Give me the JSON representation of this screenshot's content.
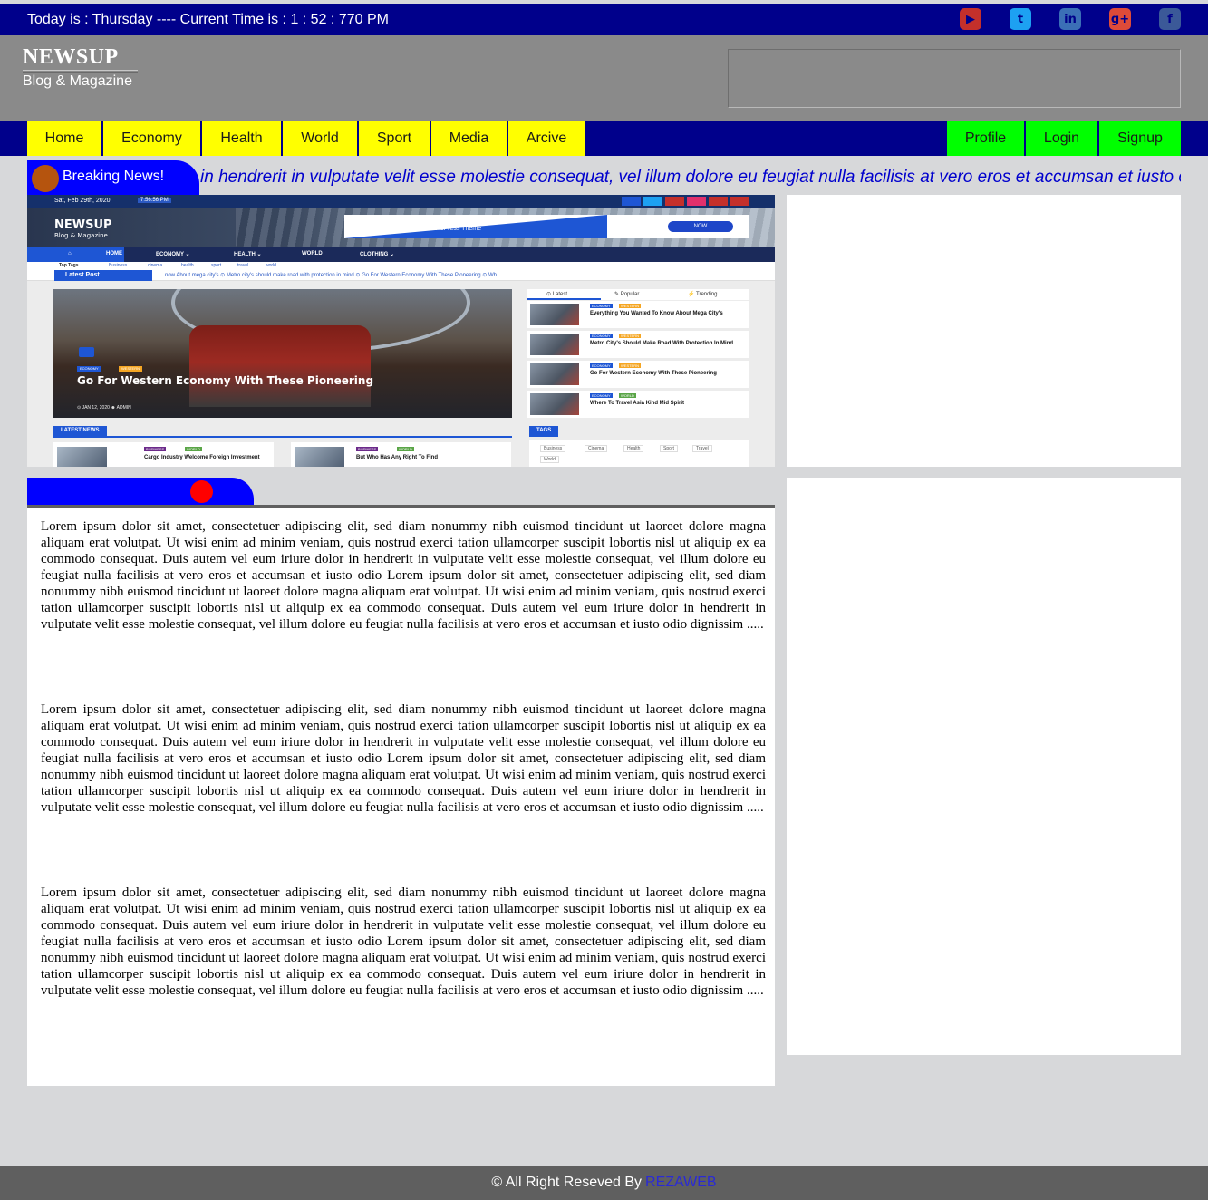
{
  "topbar": {
    "clock_text": "Today is : Thursday ---- Current Time is : 1 : 52 : 770 PM",
    "social": [
      {
        "icon": "youtube-icon",
        "glyph": "▶",
        "color": "#ff0000"
      },
      {
        "icon": "twitter-icon",
        "glyph": "t",
        "color": "#1da1f2"
      },
      {
        "icon": "linkedin-icon",
        "glyph": "in",
        "color": "#3b6fb6"
      },
      {
        "icon": "googleplus-icon",
        "glyph": "g+",
        "color": "#dd4b39"
      },
      {
        "icon": "facebook-icon",
        "glyph": "f",
        "color": "#3b5998"
      }
    ]
  },
  "header": {
    "logo_title": "NEWSUP",
    "logo_subtitle": "Blog & Magazine"
  },
  "nav": {
    "left_items": [
      "Home",
      "Economy",
      "Health",
      "World",
      "Sport",
      "Media",
      "Arcive"
    ],
    "right_items": [
      "Profile",
      "Login",
      "Signup"
    ]
  },
  "breaking": {
    "label": "Breaking News!",
    "ticker": "in hendrerit in vulputate velit esse molestie consequat, vel illum dolore eu feugiat nulla facilisis at vero eros et accumsan et iusto odio dignissim"
  },
  "preview": {
    "date": "Sat, Feb 29th, 2020",
    "time": "7:56:56 PM",
    "logo_title": "NEWSUP",
    "logo_subtitle": "Blog & Magazine",
    "banner_text": "Blog & Magazine WordPress Theme",
    "banner_button": "NOW",
    "nav_items": [
      "HOME",
      "ECONOMY ⌄",
      "HEALTH ⌄",
      "WORLD",
      "CLOTHING ⌄"
    ],
    "tags_label": "Top Tags",
    "top_tags": [
      "Business",
      "cinema",
      "health",
      "sport",
      "travel",
      "world"
    ],
    "latest_label": "Latest Post",
    "latest_ticker": "now About mega city's   ⊙ Metro city's should make road with protection in mind   ⊙ Go For Western Economy With These Pioneering   ⊙ Wh",
    "hero_tags": [
      "ECONOMY",
      "WESTERN"
    ],
    "hero_title": "Go For Western Economy With These Pioneering",
    "hero_meta": "⊙ JAN 12, 2020    ☻ ADMIN",
    "tabs": [
      "⊙ Latest",
      "✎ Popular",
      "⚡ Trending"
    ],
    "side_items": [
      {
        "tags": [
          "ECONOMY",
          "WESTERN"
        ],
        "title": "Everything You Wanted To Know About Mega City's"
      },
      {
        "tags": [
          "ECONOMY",
          "WESTERN"
        ],
        "title": "Metro City's Should Make Road With Protection In Mind"
      },
      {
        "tags": [
          "ECONOMY",
          "WESTERN"
        ],
        "title": "Go For Western Economy With These Pioneering"
      },
      {
        "tags": [
          "ECONOMY",
          "WORLD"
        ],
        "title": "Where To Travel Asia Kind Mid Spirit"
      }
    ],
    "latest_news_label": "LATEST NEWS",
    "cards": [
      {
        "tags": [
          "BUSINESS",
          "WORLD"
        ],
        "title": "Cargo Industry Welcome Foreign Investment"
      },
      {
        "tags": [
          "BUSINESS",
          "WORLD"
        ],
        "title": "But Who Has Any Right To Find"
      }
    ],
    "tags_box_label": "TAGS",
    "tag_cloud": [
      "Business",
      "Cinema",
      "Health",
      "Sport",
      "Travel",
      "World"
    ]
  },
  "article": {
    "paragraphs": [
      "Lorem ipsum dolor sit amet, consectetuer adipiscing elit, sed diam nonummy nibh euismod tincidunt ut laoreet dolore magna aliquam erat volutpat. Ut wisi enim ad minim veniam, quis nostrud exerci tation ullamcorper suscipit lobortis nisl ut aliquip ex ea commodo consequat. Duis autem vel eum iriure dolor in hendrerit in vulputate velit esse molestie consequat, vel illum dolore eu feugiat nulla facilisis at vero eros et accumsan et iusto odio Lorem ipsum dolor sit amet, consectetuer adipiscing elit, sed diam nonummy nibh euismod tincidunt ut laoreet dolore magna aliquam erat volutpat. Ut wisi enim ad minim veniam, quis nostrud exerci tation ullamcorper suscipit lobortis nisl ut aliquip ex ea commodo consequat. Duis autem vel eum iriure dolor in hendrerit in vulputate velit esse molestie consequat, vel illum dolore eu feugiat nulla facilisis at vero eros et accumsan et iusto odio dignissim .....",
      "Lorem ipsum dolor sit amet, consectetuer adipiscing elit, sed diam nonummy nibh euismod tincidunt ut laoreet dolore magna aliquam erat volutpat. Ut wisi enim ad minim veniam, quis nostrud exerci tation ullamcorper suscipit lobortis nisl ut aliquip ex ea commodo consequat. Duis autem vel eum iriure dolor in hendrerit in vulputate velit esse molestie consequat, vel illum dolore eu feugiat nulla facilisis at vero eros et accumsan et iusto odio Lorem ipsum dolor sit amet, consectetuer adipiscing elit, sed diam nonummy nibh euismod tincidunt ut laoreet dolore magna aliquam erat volutpat. Ut wisi enim ad minim veniam, quis nostrud exerci tation ullamcorper suscipit lobortis nisl ut aliquip ex ea commodo consequat. Duis autem vel eum iriure dolor in hendrerit in vulputate velit esse molestie consequat, vel illum dolore eu feugiat nulla facilisis at vero eros et accumsan et iusto odio dignissim .....",
      "Lorem ipsum dolor sit amet, consectetuer adipiscing elit, sed diam nonummy nibh euismod tincidunt ut laoreet dolore magna aliquam erat volutpat. Ut wisi enim ad minim veniam, quis nostrud exerci tation ullamcorper suscipit lobortis nisl ut aliquip ex ea commodo consequat. Duis autem vel eum iriure dolor in hendrerit in vulputate velit esse molestie consequat, vel illum dolore eu feugiat nulla facilisis at vero eros et accumsan et iusto odio Lorem ipsum dolor sit amet, consectetuer adipiscing elit, sed diam nonummy nibh euismod tincidunt ut laoreet dolore magna aliquam erat volutpat. Ut wisi enim ad minim veniam, quis nostrud exerci tation ullamcorper suscipit lobortis nisl ut aliquip ex ea commodo consequat. Duis autem vel eum iriure dolor in hendrerit in vulputate velit esse molestie consequat, vel illum dolore eu feugiat nulla facilisis at vero eros et accumsan et iusto odio dignissim ....."
    ]
  },
  "footer": {
    "text": "© All Right Reseved By",
    "link": "REZAWEB"
  },
  "colors": {
    "topbar": "#00008b",
    "nav_left": "#ffff00",
    "nav_right": "#00ff00",
    "breaking": "#0000ff",
    "footer": "#5f5f5f",
    "accent_red": "#ff0000"
  }
}
